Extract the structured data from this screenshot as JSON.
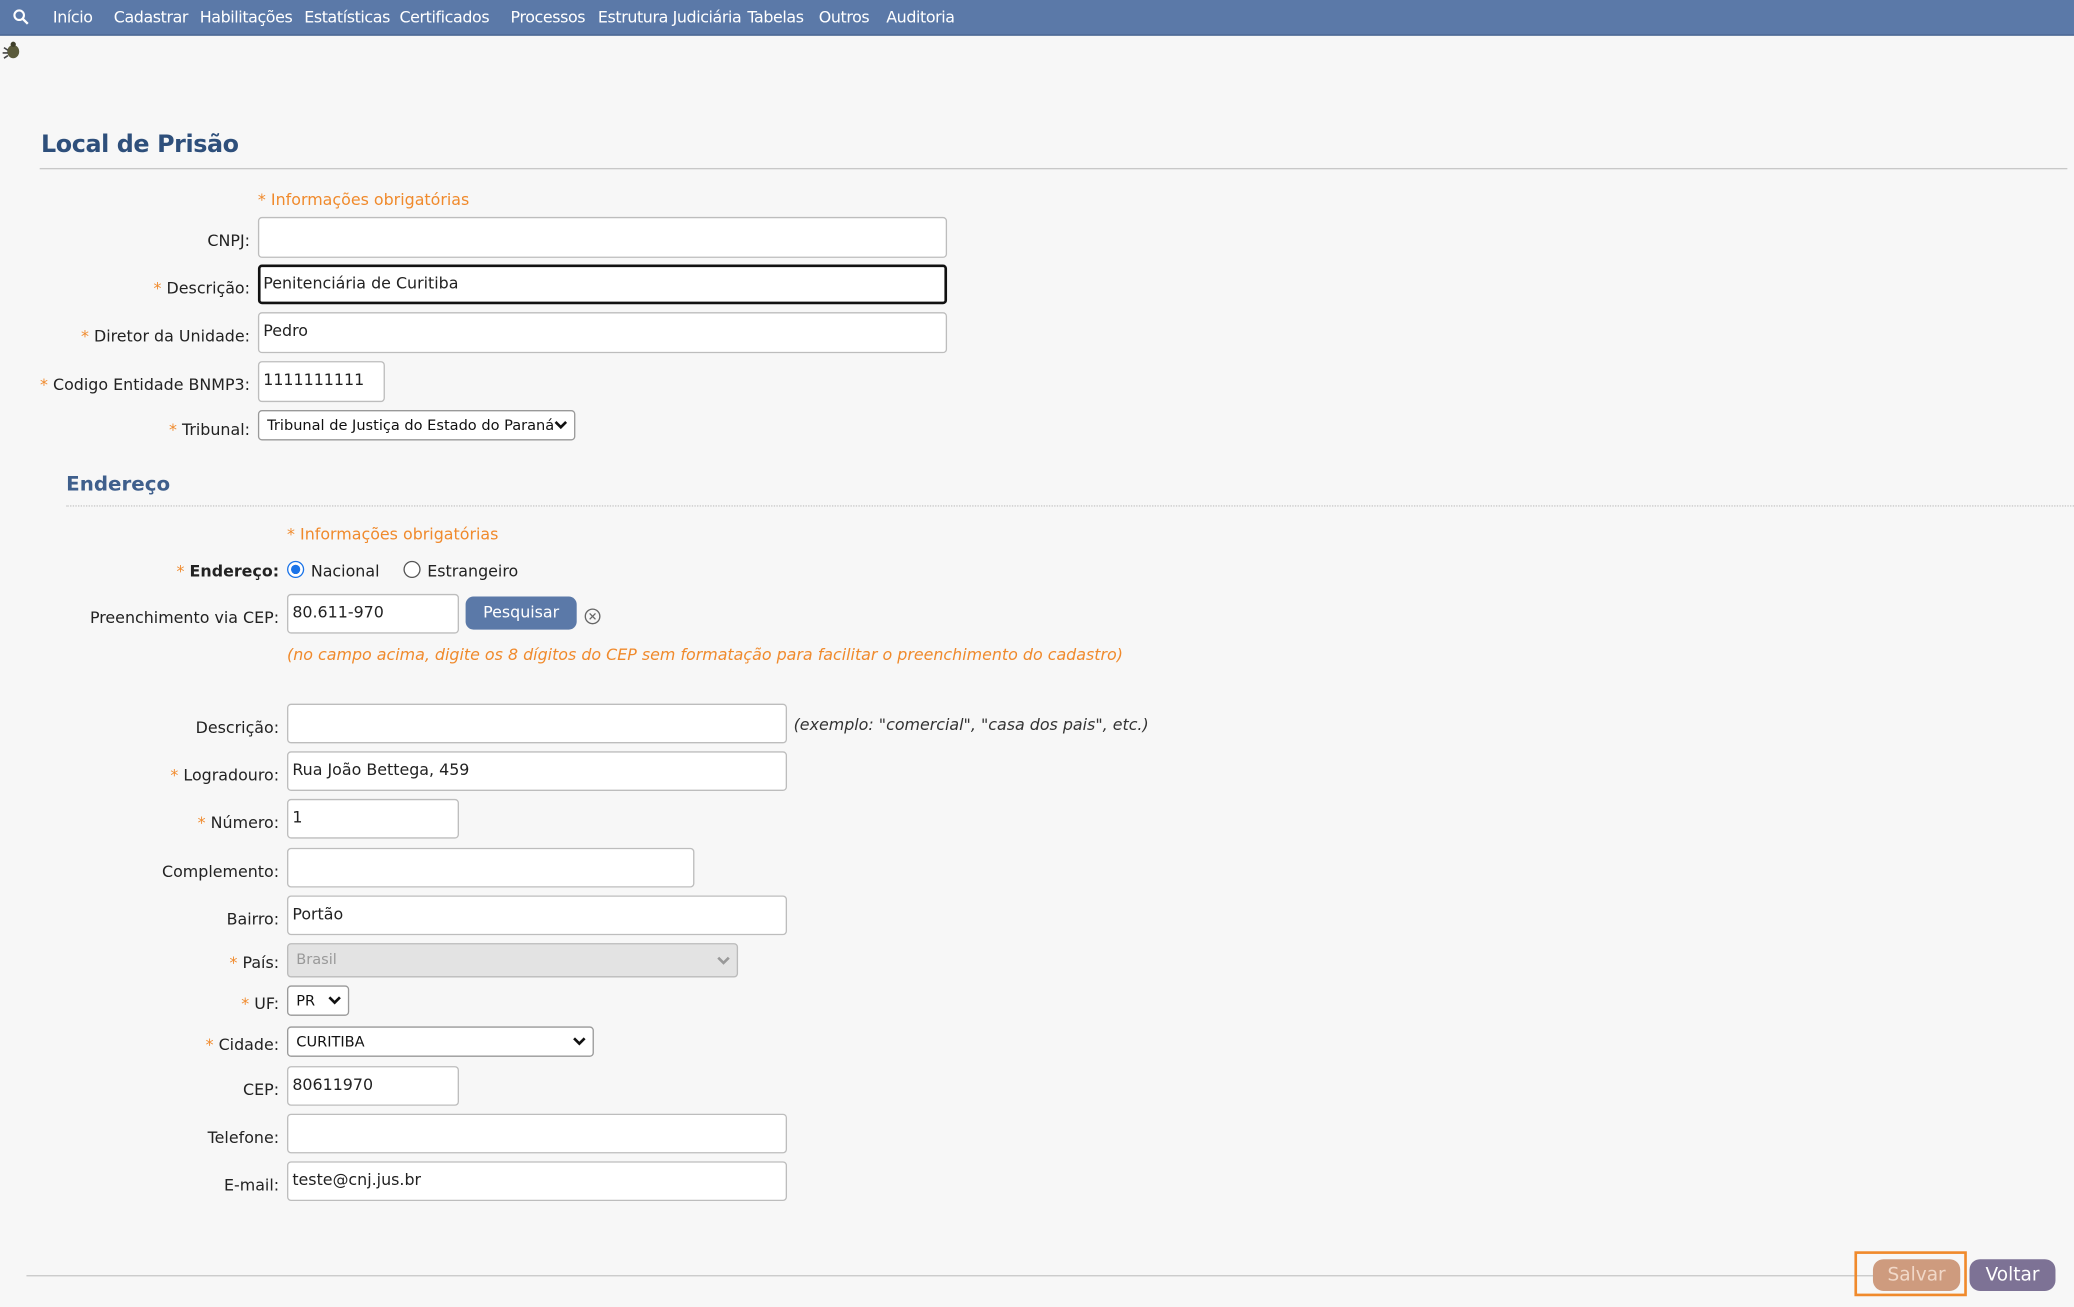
{
  "nav": {
    "items": [
      "Início",
      "Cadastrar",
      "Habilitações",
      "Estatísticas",
      "Certificados",
      "Processos",
      "Estrutura Judiciária",
      "Tabelas",
      "Outros",
      "Auditoria"
    ]
  },
  "page": {
    "title": "Local de Prisão"
  },
  "required_note": "* Informações obrigatórias",
  "form": {
    "cnpj": {
      "label": "CNPJ:",
      "value": ""
    },
    "descricao": {
      "label": "Descrição:",
      "value": "Penitenciária de Curitiba"
    },
    "diretor": {
      "label": "Diretor da Unidade:",
      "value": "Pedro"
    },
    "codigo": {
      "label": "Codigo Entidade BNMP3:",
      "value": "1111111111"
    },
    "tribunal": {
      "label": "Tribunal:",
      "value": "Tribunal de Justiça do Estado do Paraná"
    }
  },
  "endereco": {
    "section_title": "Endereço",
    "tipo_label": "Endereço:",
    "options": [
      "Nacional",
      "Estrangeiro"
    ],
    "selected": "Nacional",
    "cep_search": {
      "label": "Preenchimento via CEP:",
      "value": "80.611-970",
      "button": "Pesquisar"
    },
    "hint": "(no campo acima, digite os 8 dígitos do CEP sem formatação para facilitar o preenchimento do cadastro)",
    "descricao": {
      "label": "Descrição:",
      "value": "",
      "example": "(exemplo: \"comercial\", \"casa dos pais\", etc.)"
    },
    "logradouro": {
      "label": "Logradouro:",
      "value": "Rua João Bettega, 459"
    },
    "numero": {
      "label": "Número:",
      "value": "1"
    },
    "complemento": {
      "label": "Complemento:",
      "value": ""
    },
    "bairro": {
      "label": "Bairro:",
      "value": "Portão"
    },
    "pais": {
      "label": "País:",
      "value": "Brasil"
    },
    "uf": {
      "label": "UF:",
      "value": "PR"
    },
    "cidade": {
      "label": "Cidade:",
      "value": "CURITIBA"
    },
    "cep": {
      "label": "CEP:",
      "value": "80611970"
    },
    "telefone": {
      "label": "Telefone:",
      "value": ""
    },
    "email": {
      "label": "E-mail:",
      "value": "teste@cnj.jus.br"
    }
  },
  "actions": {
    "save": "Salvar",
    "back": "Voltar"
  },
  "colors": {
    "nav": "#5b79a8",
    "title": "#2e4f7b",
    "required": "#f08a2c",
    "save": "#ce9b7e",
    "back": "#7d7295"
  }
}
